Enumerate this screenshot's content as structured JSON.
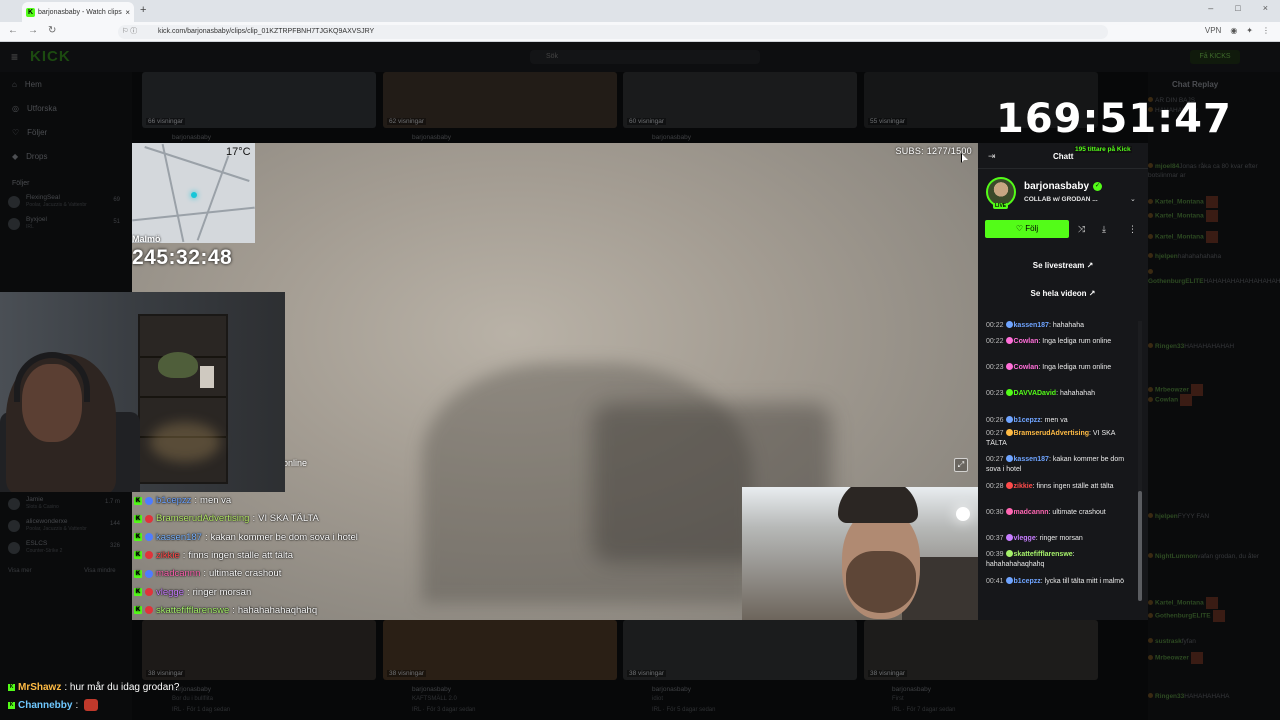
{
  "browser": {
    "tab_title": "barjonasbaby - Watch clips",
    "url": "kick.com/barjonasbaby/clips/clip_01KZTRPFBNH7TJGKQ9AXVSJRY",
    "vpn_label": "VPN"
  },
  "site": {
    "logo": "KICK",
    "search_placeholder": "Sök",
    "get_kicks": "Få KICKS",
    "nav": [
      "Hem",
      "Utforska",
      "Följer",
      "Drops"
    ],
    "follows_heading": "Följer",
    "followed": [
      {
        "name": "FlexingSeal",
        "sub": "Poolar, Jacuzzis & Vattenbr",
        "count": "69"
      },
      {
        "name": "Byxjoel",
        "sub": "IRL",
        "count": "51"
      },
      {
        "name": "Jamie",
        "sub": "Slots & Casino",
        "count": "1.7 m"
      },
      {
        "name": "alicewonderxe",
        "sub": "Poolar, Jacuzzis & Vattenbr",
        "count": "144"
      },
      {
        "name": "ESLCS",
        "sub": "Counter-Strike 2",
        "count": "326"
      }
    ],
    "show_more": "Visa mer",
    "show_less": "Visa mindre",
    "top_clips": [
      {
        "views": "66 visningar",
        "channel": "barjonasbaby"
      },
      {
        "views": "62 visningar",
        "channel": "barjonasbaby"
      },
      {
        "views": "60 visningar",
        "channel": "barjonasbaby"
      },
      {
        "views": "55 visningar",
        "channel": "barjonasbaby"
      }
    ],
    "bottom_clips": [
      {
        "views": "38 visningar",
        "channel": "barjonasbaby",
        "title": "Bor du i bullflita",
        "meta": "IRL · För 1 dag sedan"
      },
      {
        "views": "38 visningar",
        "channel": "barjonasbaby",
        "title": "KAFTSMÄLL 2.0",
        "meta": "IRL · För 3 dagar sedan"
      },
      {
        "views": "38 visningar",
        "channel": "barjonasbaby",
        "title": "idiot",
        "meta": "IRL · För 5 dagar sedan"
      },
      {
        "views": "38 visningar",
        "channel": "barjonasbaby",
        "title": "First",
        "meta": "IRL · För 7 dagar sedan"
      }
    ]
  },
  "chat_replay": {
    "title": "Chat Replay",
    "lines": [
      {
        "user": "",
        "text": "AR DIN BAJS"
      },
      {
        "user": "",
        "text": "HAHAHAHA fy"
      },
      {
        "user": "mjoel84",
        "text": "Jonas råka ca 80 kvar efter botslinmar ar"
      },
      {
        "user": "Kartel_Montana",
        "text": ""
      },
      {
        "user": "Kartel_Montana",
        "text": ""
      },
      {
        "user": "Kartel_Montana",
        "text": ""
      },
      {
        "user": "hjelpen",
        "text": "hahahahahaha"
      },
      {
        "user": "GothenburgELITE",
        "text": "HAHAHAHAHAHAHAHAHAHAHAHAHAHAHA"
      },
      {
        "user": "Ringen33",
        "text": "HAHAHAHAHAH"
      },
      {
        "user": "Mrbeowzer",
        "text": ""
      },
      {
        "user": "Cowlan",
        "text": ""
      },
      {
        "user": "hjelpen",
        "text": "FYYY FAN"
      },
      {
        "user": "NightLumnon",
        "text": "vafan grodan, du åter"
      },
      {
        "user": "Kartel_Montana",
        "text": ""
      },
      {
        "user": "GothenburgELITE",
        "text": ""
      },
      {
        "user": "sustrask",
        "text": "fyfan"
      },
      {
        "user": "Mrbeowzer",
        "text": ""
      },
      {
        "user": "Ringen33",
        "text": "HAHAHAHAHA"
      }
    ]
  },
  "video": {
    "temperature": "17°C",
    "city": "Malmö",
    "secondary_timer": "245:32:48",
    "subs": "SUBS: 1277/1500",
    "online_fragment": "online",
    "overlay_chat": [
      {
        "user": "b1cepzz",
        "text": "men va",
        "color": "#6fa4ff",
        "badge": "#4e7cff"
      },
      {
        "user": "BramserudAdvertising",
        "text": "VI SKA TÄLTA",
        "color": "#b5e86a",
        "badge": "#e0333a"
      },
      {
        "user": "kassen187",
        "text": "kakan kommer be dom sova i hotel",
        "color": "#7bb4ff",
        "badge": "#4e7cff"
      },
      {
        "user": "zikkie",
        "text": "finns ingen ställe att tälta",
        "color": "#ff4b4b",
        "badge": "#e0333a"
      },
      {
        "user": "madcannn",
        "text": "ultimate crashout",
        "color": "#ff66b2",
        "badge": "#4e7cff"
      },
      {
        "user": "vlegge",
        "text": "ringer morsan",
        "color": "#c77dff",
        "badge": "#e0333a"
      },
      {
        "user": "skattefifflarenswe",
        "text": "hahahahahaqhahq",
        "color": "#a5f06a",
        "badge": "#e0333a"
      }
    ]
  },
  "big_timer": "169:51:47",
  "chat_panel": {
    "title": "Chatt",
    "viewers": "195 tittare på Kick",
    "channel": "barjonasbaby",
    "live_label": "LIVE",
    "stream_title": "COLLAB w/ GRODAN ...",
    "follow_label": "Följ",
    "livestream_link": "Se livestream",
    "full_video_link": "Se hela videon",
    "messages": [
      {
        "time": "00:22",
        "user": "kassen187",
        "text": ": hahahaha",
        "color": "#6fa4ff"
      },
      {
        "time": "00:22",
        "user": "Cowlan",
        "text": ": Inga lediga rum online",
        "color": "#ff6fd8"
      },
      {
        "time": "00:23",
        "user": "Cowlan",
        "text": ": Inga lediga rum online",
        "color": "#ff6fd8"
      },
      {
        "time": "00:23",
        "user": "DAVVADavid",
        "text": ": hahahahah",
        "color": "#53fc18"
      },
      {
        "time": "00:26",
        "user": "b1cepzz",
        "text": ": men va",
        "color": "#6fa4ff"
      },
      {
        "time": "00:27",
        "user": "BramserudAdvertising",
        "text": ": VI SKA TÄLTA",
        "color": "#ffbb44"
      },
      {
        "time": "00:27",
        "user": "kassen187",
        "text": ": kakan kommer be dom sova i hotel",
        "color": "#6fa4ff"
      },
      {
        "time": "00:28",
        "user": "zikkie",
        "text": ": finns ingen ställe att tälta",
        "color": "#ff4b4b"
      },
      {
        "time": "00:30",
        "user": "madcannn",
        "text": ": ultimate crashout",
        "color": "#ff66b2"
      },
      {
        "time": "00:37",
        "user": "vlegge",
        "text": ": ringer morsan",
        "color": "#c77dff"
      },
      {
        "time": "00:39",
        "user": "skattefifflarenswe",
        "text": ": hahahahahaqhahq",
        "color": "#a5f06a"
      },
      {
        "time": "00:41",
        "user": "b1cepzz",
        "text": ": lycka till tälta mitt i malmö",
        "color": "#6fa4ff"
      }
    ]
  },
  "bottom_overlay": [
    {
      "user": "MrShawz",
      "text": ": hur mår du idag grodan?",
      "color": "#ffbb44"
    },
    {
      "user": "Channebby",
      "text": ":",
      "color": "#6fc8ff"
    }
  ]
}
